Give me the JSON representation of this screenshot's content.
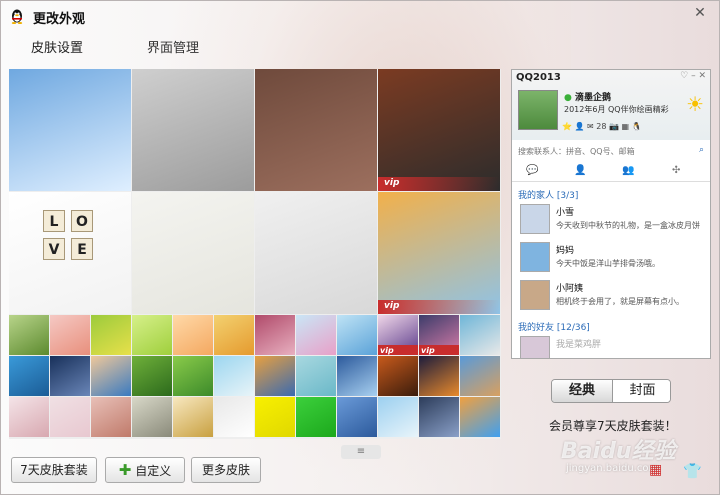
{
  "window": {
    "title": "更改外观",
    "close_label": "✕"
  },
  "tabs": [
    {
      "label": "皮肤设置",
      "active": true
    },
    {
      "label": "界面管理",
      "active": false
    }
  ],
  "skins": {
    "vip_label": "vip",
    "large": [
      {
        "name": "sky-clouds",
        "colors": [
          "#6fa8e0",
          "#dfefff"
        ]
      },
      {
        "name": "running-silhouettes",
        "colors": [
          "#cfcfcf",
          "#9c9c9c"
        ]
      },
      {
        "name": "coffee",
        "colors": [
          "#6f4a3c",
          "#9c6f5e"
        ]
      },
      {
        "name": "leather-rivets",
        "colors": [
          "#7b3b22",
          "#2c2c2c"
        ],
        "vip": true
      },
      {
        "name": "love-tiles",
        "colors": [
          "#ffffff",
          "#f2f2f2"
        ],
        "tiles": [
          "L",
          "O",
          "V",
          "E"
        ]
      },
      {
        "name": "sketch-girl",
        "colors": [
          "#f4f4f0",
          "#e5e5de"
        ]
      },
      {
        "name": "dandelion-couple",
        "colors": [
          "#f0f0f0",
          "#d8d8d8"
        ]
      },
      {
        "name": "camera-photos",
        "colors": [
          "#f2b04a",
          "#8ec3e8"
        ],
        "vip": true
      }
    ],
    "small_rows": [
      [
        {
          "c": [
            "#b8d48a",
            "#5c8a2e"
          ]
        },
        {
          "c": [
            "#f5c9c4",
            "#e88f7c"
          ]
        },
        {
          "c": [
            "#9ccb3c",
            "#e7e04a"
          ]
        },
        {
          "c": [
            "#d6f08a",
            "#9fcf3c"
          ]
        },
        {
          "c": [
            "#ffd9a8",
            "#f4a860"
          ]
        },
        {
          "c": [
            "#f3d170",
            "#e59a2e"
          ]
        },
        {
          "c": [
            "#b04a6a",
            "#e8b0c0"
          ]
        },
        {
          "c": [
            "#c9e6f6",
            "#e8a0c8"
          ]
        },
        {
          "c": [
            "#bfe3f5",
            "#5aa2d8"
          ]
        },
        {
          "c": [
            "#f0d7e8",
            "#5a3a8a"
          ],
          "vip": true
        },
        {
          "c": [
            "#3c3c6a",
            "#d87ca8"
          ],
          "vip": true
        },
        {
          "c": [
            "#6fb6d8",
            "#e8e8e8"
          ]
        }
      ],
      [
        {
          "c": [
            "#3a9ad9",
            "#1b5c96"
          ]
        },
        {
          "c": [
            "#18305a",
            "#6a86b8"
          ]
        },
        {
          "c": [
            "#f0c89a",
            "#3a7ac0"
          ]
        },
        {
          "c": [
            "#6fb03a",
            "#2c6a1c"
          ]
        },
        {
          "c": [
            "#8acb4a",
            "#3c8a2a"
          ]
        },
        {
          "c": [
            "#9cd6f0",
            "#e8f4f8"
          ]
        },
        {
          "c": [
            "#e8a040",
            "#3a6ab0"
          ]
        },
        {
          "c": [
            "#a8d8e0",
            "#6ab8c8"
          ]
        },
        {
          "c": [
            "#2c5a9c",
            "#a8d0f0"
          ]
        },
        {
          "c": [
            "#c85a1c",
            "#3a1c0c"
          ]
        },
        {
          "c": [
            "#1c1c3c",
            "#e88a2c"
          ]
        },
        {
          "c": [
            "#5a9ad8",
            "#d8a060"
          ]
        }
      ],
      [
        {
          "c": [
            "#f4e4e8",
            "#d8a8b0"
          ]
        },
        {
          "c": [
            "#f0e0e4",
            "#e8c8d0"
          ]
        },
        {
          "c": [
            "#e8c0b8",
            "#c07a6a"
          ]
        },
        {
          "c": [
            "#d8d8c8",
            "#8a8a7a"
          ]
        },
        {
          "c": [
            "#f8e8c0",
            "#c8a040"
          ]
        },
        {
          "c": [
            "#e8e8e8",
            "#ffffff"
          ]
        },
        {
          "c": [
            "#f8f000",
            "#e0d800"
          ]
        },
        {
          "c": [
            "#3cd03c",
            "#1ca81c"
          ]
        },
        {
          "c": [
            "#6a9ad8",
            "#2c5a9c"
          ]
        },
        {
          "c": [
            "#9cd0f0",
            "#e8f4fa"
          ]
        },
        {
          "c": [
            "#2c3c5a",
            "#8aa0c8"
          ]
        },
        {
          "c": [
            "#f0a040",
            "#40a0f0"
          ]
        }
      ]
    ]
  },
  "buttons": {
    "suit": "7天皮肤套装",
    "custom": "自定义",
    "more": "更多皮肤",
    "expand": "≡"
  },
  "preview": {
    "title": "QQ2013",
    "nickname": "滴墨企鹅",
    "signature": "2012年6月 QQ伴你绘画精彩",
    "icon_counts": "28",
    "search_placeholder": "搜索联系人：拼音、QQ号、邮箱",
    "tab_icons": [
      "💬",
      "👤",
      "👥",
      "✣"
    ],
    "groups": [
      {
        "label": "我的家人 [3/3]"
      },
      {
        "label": "我的好友 [12/36]"
      }
    ],
    "contacts": [
      {
        "name": "小雪",
        "message": "今天收到中秋节的礼物，是一盒冰皮月饼",
        "color": "#c9d6e8"
      },
      {
        "name": "妈妈",
        "message": "今天中饭是洋山芋排骨汤哦。",
        "color": "#7fb4e0"
      },
      {
        "name": "小阿姨",
        "message": "相机终于会用了，就是屏幕有点小。",
        "color": "#c8a888"
      }
    ],
    "next_contact": "我是菜鸡胖"
  },
  "mode": {
    "classic": "经典",
    "cover": "封面"
  },
  "vip_note": "会员尊享7天皮肤套装！",
  "watermark": {
    "main": "Baidu经验",
    "sub": "jingyan.baidu.com"
  }
}
